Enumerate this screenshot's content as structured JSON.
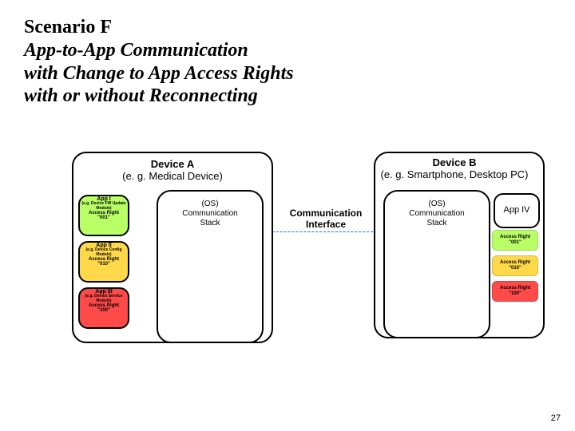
{
  "title": {
    "line1": "Scenario F",
    "line2": "App-to-App Communication",
    "line3": "with Change to App Access Rights",
    "line4": "with or without Reconnecting"
  },
  "deviceA": {
    "name": "Device A",
    "example": "(e. g. Medical Device)",
    "stack": {
      "l1": "(OS)",
      "l2": "Communication",
      "l3": "Stack"
    },
    "apps": [
      {
        "name": "App I",
        "sub": "(e.g. Device FW Update Module)",
        "ar_label": "Access Right",
        "ar_val": "\"001\""
      },
      {
        "name": "App II",
        "sub": "(e.g. Device Config Module)",
        "ar_label": "Access Right",
        "ar_val": "\"010\""
      },
      {
        "name": "App III",
        "sub": "(e.g. Device Service Module)",
        "ar_label": "Access Right",
        "ar_val": "\"100\""
      }
    ]
  },
  "deviceB": {
    "name": "Device B",
    "example": "(e. g. Smartphone, Desktop PC)",
    "stack": {
      "l1": "(OS)",
      "l2": "Communication",
      "l3": "Stack"
    },
    "app": {
      "name": "App IV"
    },
    "rights": [
      {
        "ar_label": "Access Right",
        "ar_val": "\"001\""
      },
      {
        "ar_label": "Access Right",
        "ar_val": "\"010\""
      },
      {
        "ar_label": "Access Right",
        "ar_val": "\"100\""
      }
    ]
  },
  "comm_interface": {
    "l1": "Communication",
    "l2": "Interface"
  },
  "page_number": "27"
}
